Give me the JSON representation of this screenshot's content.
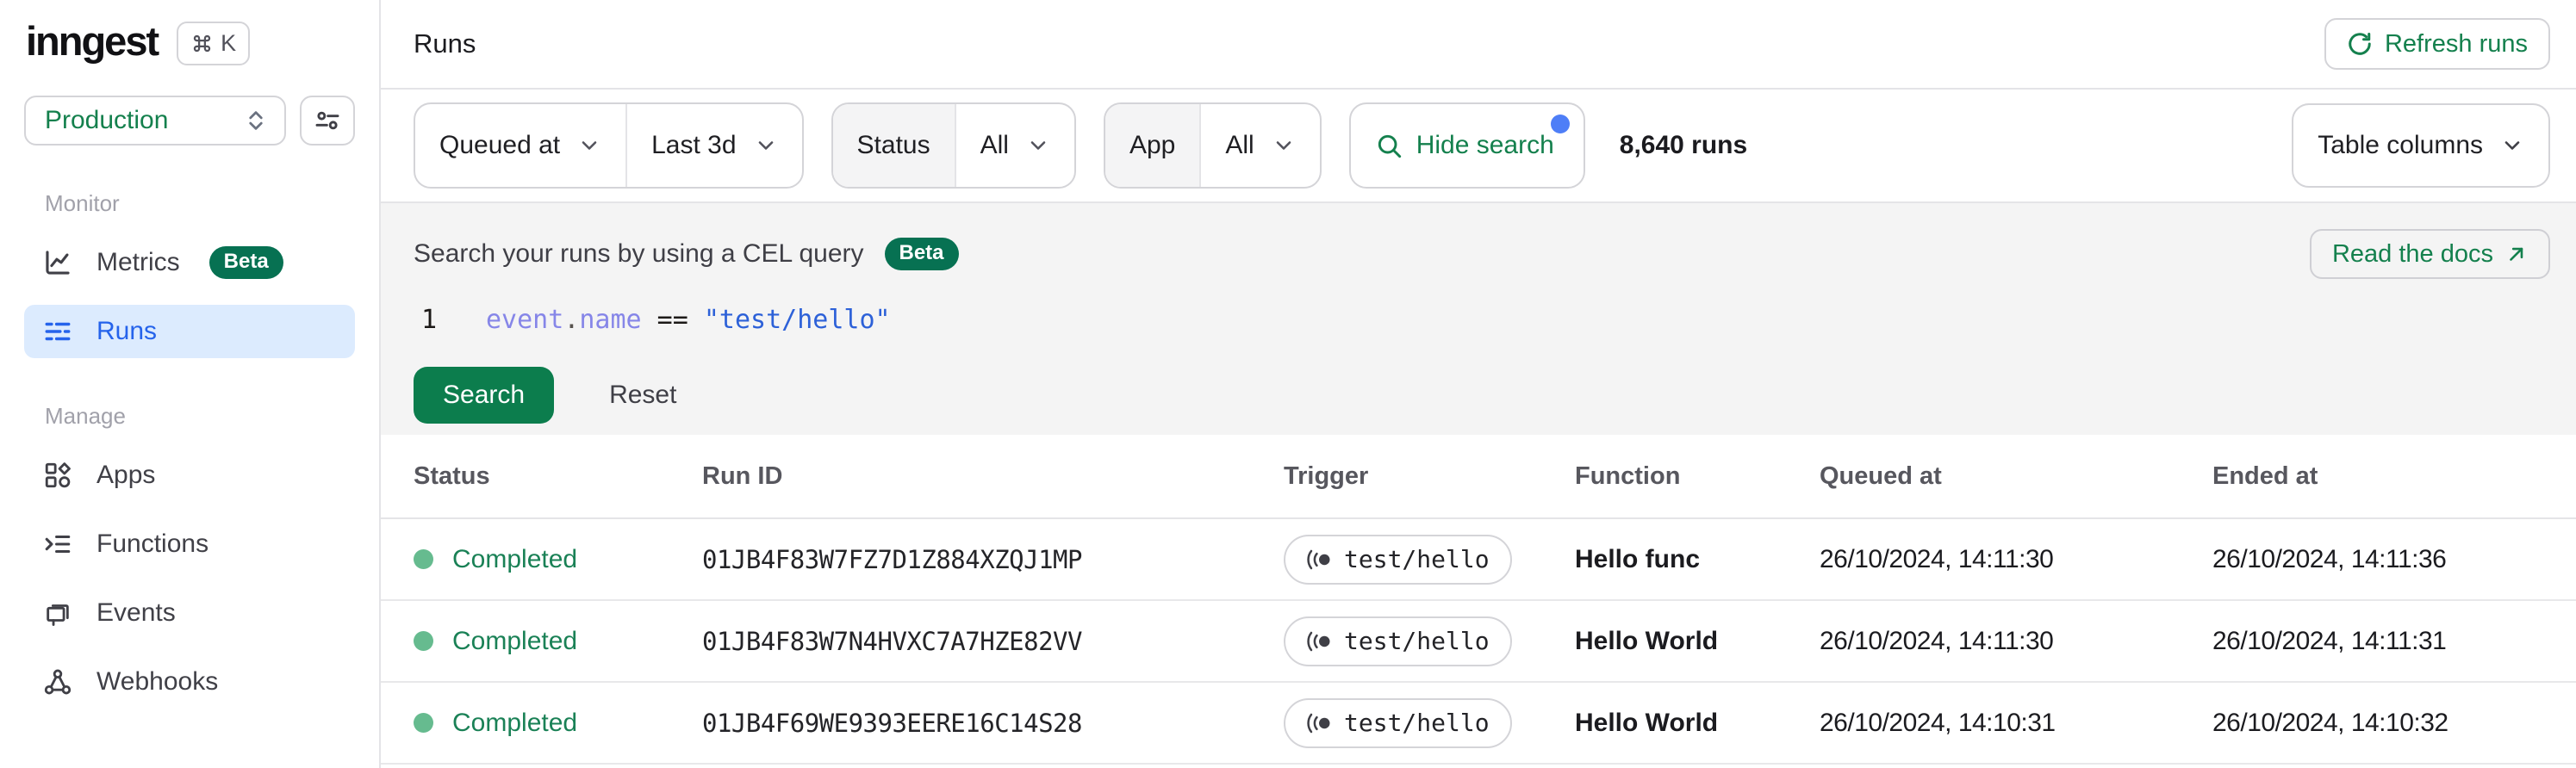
{
  "sidebar": {
    "logo": "inngest",
    "shortcut_key": "K",
    "environment": "Production",
    "monitor_label": "Monitor",
    "manage_label": "Manage",
    "metrics_label": "Metrics",
    "metrics_badge": "Beta",
    "runs_label": "Runs",
    "apps_label": "Apps",
    "functions_label": "Functions",
    "events_label": "Events",
    "webhooks_label": "Webhooks"
  },
  "header": {
    "title": "Runs",
    "refresh_button": "Refresh runs"
  },
  "filters": {
    "time_field": "Queued at",
    "time_range": "Last 3d",
    "status_label": "Status",
    "status_value": "All",
    "app_label": "App",
    "app_value": "All",
    "search_toggle": "Hide search",
    "runs_count": "8,640 runs",
    "table_columns": "Table columns"
  },
  "search_panel": {
    "title": "Search your runs by using a CEL query",
    "badge": "Beta",
    "docs_button": "Read the docs",
    "line_number": "1",
    "code": {
      "object": "event",
      "dot": ".",
      "property": "name",
      "operator": " == ",
      "string": "\"test/hello\""
    },
    "search_button": "Search",
    "reset_button": "Reset"
  },
  "table": {
    "columns": {
      "status": "Status",
      "run_id": "Run ID",
      "trigger": "Trigger",
      "function": "Function",
      "queued_at": "Queued at",
      "ended_at": "Ended at"
    },
    "rows": [
      {
        "status": "Completed",
        "run_id": "01JB4F83W7FZ7D1Z884XZQJ1MP",
        "trigger": "test/hello",
        "function": "Hello func",
        "queued_at": "26/10/2024, 14:11:30",
        "ended_at": "26/10/2024, 14:11:36"
      },
      {
        "status": "Completed",
        "run_id": "01JB4F83W7N4HVXC7A7HZE82VV",
        "trigger": "test/hello",
        "function": "Hello World",
        "queued_at": "26/10/2024, 14:11:30",
        "ended_at": "26/10/2024, 14:11:31"
      },
      {
        "status": "Completed",
        "run_id": "01JB4F69WE9393EERE16C14S28",
        "trigger": "test/hello",
        "function": "Hello World",
        "queued_at": "26/10/2024, 14:10:31",
        "ended_at": "26/10/2024, 14:10:32"
      }
    ]
  },
  "colors": {
    "brand_green_text": "#14804D",
    "solid_green_button": "#0C7D4D",
    "beta_badge_green": "#077152",
    "status_dot_green": "#66BB8F",
    "active_item_blue_bg": "#DCEBFE",
    "active_item_blue_text": "#2563EB",
    "notification_dot_blue": "#4E7EF7",
    "code_identifier_purple": "#8686E8",
    "code_string_blue": "#2D61D8",
    "panel_background_grey": "#F4F4F4"
  }
}
